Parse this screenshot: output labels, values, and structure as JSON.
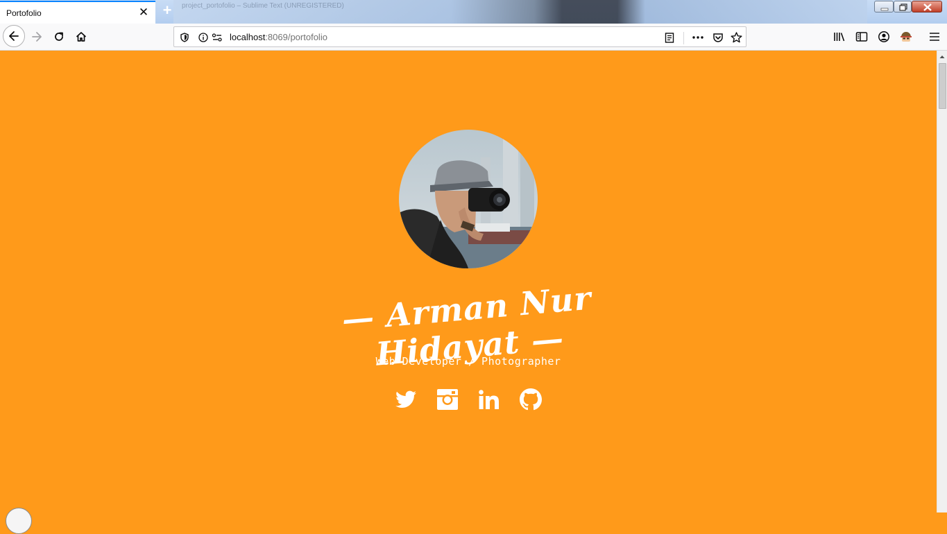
{
  "tab": {
    "title": "Portofolio",
    "close_glyph": "✕"
  },
  "newtab": {
    "glyph": "+"
  },
  "background_tab_text": "project_portofolio – Sublime Text (UNREGISTERED)",
  "url": {
    "host": "localhost",
    "rest": ":8069/portofolio"
  },
  "profile": {
    "name": "— Arman Nur Hidayat —",
    "subtitle": "Web Developer / Photographer"
  },
  "socials": [
    "twitter-icon",
    "instagram-icon",
    "linkedin-icon",
    "github-icon"
  ],
  "colors": {
    "page_bg": "#ff9a1a",
    "text": "#ffffff",
    "accent": "#0a84ff"
  }
}
